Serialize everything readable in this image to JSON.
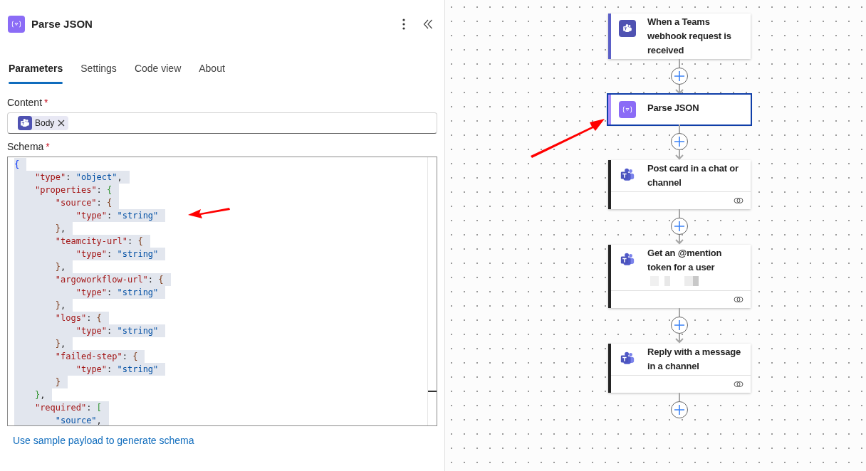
{
  "panel": {
    "title": "Parse JSON",
    "tabs": [
      {
        "label": "Parameters",
        "selected": true
      },
      {
        "label": "Settings",
        "selected": false
      },
      {
        "label": "Code view",
        "selected": false
      },
      {
        "label": "About",
        "selected": false
      }
    ],
    "content_field": {
      "label": "Content",
      "required_mark": "*",
      "token": "Body"
    },
    "schema_field": {
      "label": "Schema",
      "required_mark": "*",
      "selected": true,
      "lines": [
        "{",
        "    \"type\": \"object\",",
        "    \"properties\": {",
        "        \"source\": {",
        "            \"type\": \"string\"",
        "        },",
        "        \"teamcity-url\": {",
        "            \"type\": \"string\"",
        "        },",
        "        \"argoworkflow-url\": {",
        "            \"type\": \"string\"",
        "        },",
        "        \"logs\": {",
        "            \"type\": \"string\"",
        "        },",
        "        \"failed-step\": {",
        "            \"type\": \"string\"",
        "        }",
        "    },",
        "    \"required\": [",
        "        \"source\","
      ]
    },
    "link": "Use sample payload to generate schema"
  },
  "flow": {
    "steps": [
      {
        "kind": "teams",
        "title": "When a Teams webhook request is received",
        "color": "#5b5fc7",
        "selected": false,
        "linked": false,
        "redacted": false
      },
      {
        "kind": "parse",
        "title": "Parse JSON",
        "color": "#a78bfa",
        "selected": true,
        "linked": false,
        "redacted": false
      },
      {
        "kind": "teams",
        "title": "Post card in a chat or channel",
        "color": "#242424",
        "selected": false,
        "linked": true,
        "redacted": false
      },
      {
        "kind": "teams",
        "title": "Get an @mention token for a user",
        "color": "#242424",
        "selected": false,
        "linked": true,
        "redacted": true
      },
      {
        "kind": "teams",
        "title": "Reply with a message in a channel",
        "color": "#242424",
        "selected": false,
        "linked": true,
        "redacted": false
      }
    ]
  }
}
